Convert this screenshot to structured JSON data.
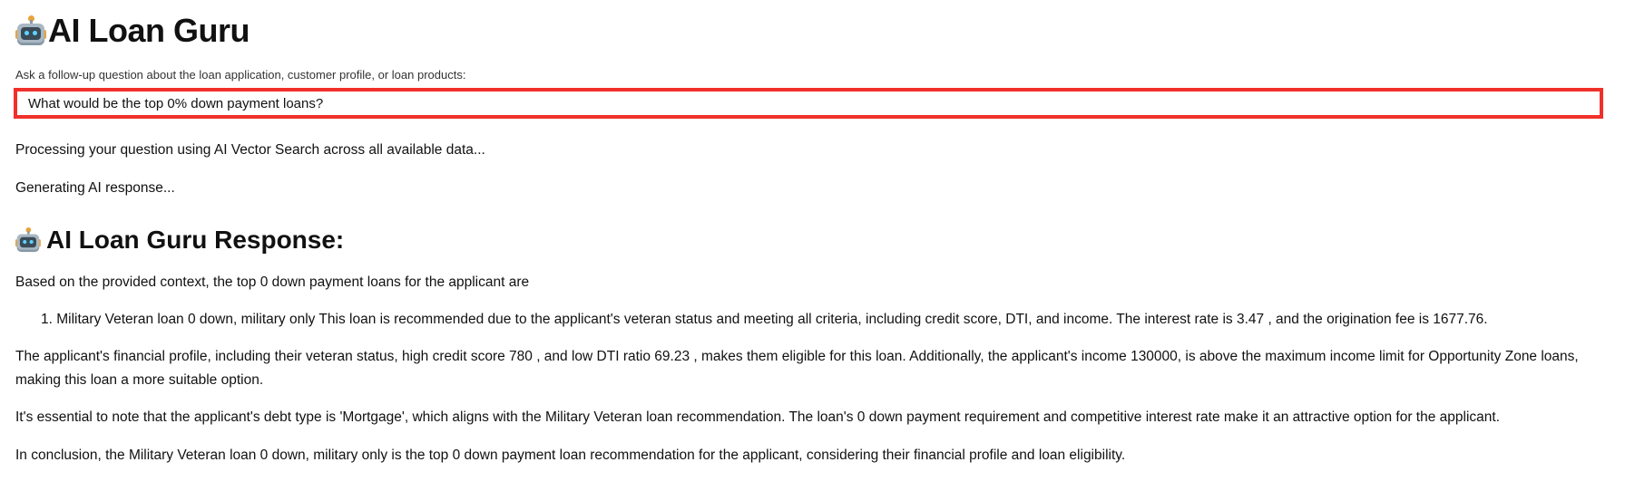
{
  "header": {
    "title": "AI Loan Guru",
    "icon": "robot-icon"
  },
  "question": {
    "label": "Ask a follow-up question about the loan application, customer profile, or loan products:",
    "value": "What would be the top 0% down payment loans?",
    "highlight_color": "#f0302a"
  },
  "status": {
    "processing": "Processing your question using AI Vector Search across all available data...",
    "generating": "Generating AI response..."
  },
  "response": {
    "title": "AI Loan Guru Response:",
    "icon": "robot-icon",
    "intro": "Based on the provided context, the top 0 down payment loans for the applicant are",
    "list": [
      {
        "number": "1.",
        "text": "Military Veteran loan 0 down, military only This loan is recommended due to the applicant's veteran status and meeting all criteria, including credit score, DTI, and income. The interest rate is 3.47 , and the origination fee is 1677.76."
      }
    ],
    "profile": "The applicant's financial profile, including their veteran status, high credit score 780 , and low DTI ratio 69.23 , makes them eligible for this loan. Additionally, the applicant's income 130000, is above the maximum income limit for Opportunity Zone loans, making this loan a more suitable option.",
    "debt_type": "It's essential to note that the applicant's debt type is 'Mortgage', which aligns with the Military Veteran loan recommendation. The loan's 0 down payment requirement and competitive interest rate make it an attractive option for the applicant.",
    "conclusion": "In conclusion, the Military Veteran loan 0 down, military only is the top 0 down payment loan recommendation for the applicant, considering their financial profile and loan eligibility."
  }
}
